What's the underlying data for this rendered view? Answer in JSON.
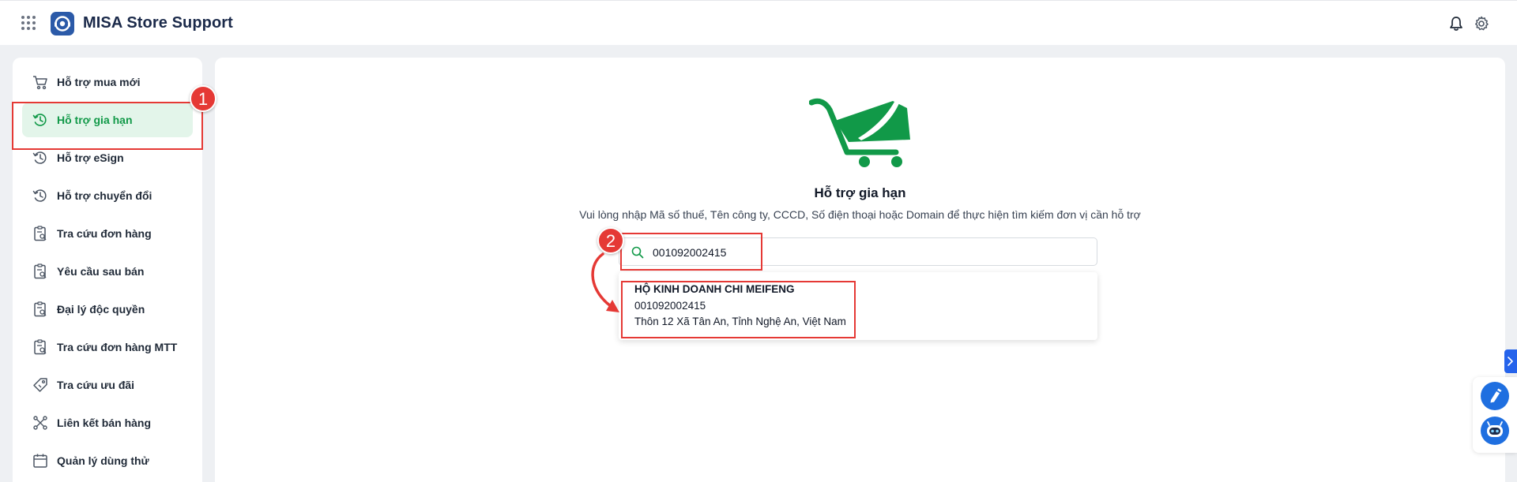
{
  "app": {
    "title": "MISA Store Support"
  },
  "sidebar": {
    "items": [
      {
        "label": "Hỗ trợ mua mới",
        "icon": "cart-icon",
        "active": false
      },
      {
        "label": "Hỗ trợ gia hạn",
        "icon": "history-icon",
        "active": true
      },
      {
        "label": "Hỗ trợ eSign",
        "icon": "history-icon",
        "active": false
      },
      {
        "label": "Hỗ trợ chuyển đổi",
        "icon": "history-icon",
        "active": false
      },
      {
        "label": "Tra cứu đơn hàng",
        "icon": "clipboard-search-icon",
        "active": false
      },
      {
        "label": "Yêu cầu sau bán",
        "icon": "clipboard-search-icon",
        "active": false
      },
      {
        "label": "Đại lý độc quyền",
        "icon": "clipboard-search-icon",
        "active": false
      },
      {
        "label": "Tra cứu đơn hàng MTT",
        "icon": "clipboard-search-icon",
        "active": false
      },
      {
        "label": "Tra cứu ưu đãi",
        "icon": "tag-icon",
        "active": false
      },
      {
        "label": "Liên kết bán hàng",
        "icon": "link-nodes-icon",
        "active": false
      },
      {
        "label": "Quản lý dùng thử",
        "icon": "calendar-icon",
        "active": false
      }
    ]
  },
  "main": {
    "title": "Hỗ trợ gia hạn",
    "subtitle": "Vui lòng nhập Mã số thuế, Tên công ty, CCCD, Số điện thoại hoặc Domain để thực hiện tìm kiếm đơn vị cần hỗ trợ",
    "search": {
      "value": "001092002415",
      "placeholder": ""
    },
    "results": [
      {
        "name": "HỘ KINH DOANH CHI MEIFENG",
        "tax_code": "001092002415",
        "address": "Thôn 12 Xã Tân An, Tỉnh Nghệ An, Việt Nam"
      }
    ]
  },
  "annotations": {
    "step1": "1",
    "step2": "2"
  },
  "colors": {
    "accent": "#119948",
    "active_bg": "#e3f5ea",
    "annotation": "#e53935",
    "brand_blue": "#2b5aa8",
    "widget_blue": "#1f6fe0"
  }
}
